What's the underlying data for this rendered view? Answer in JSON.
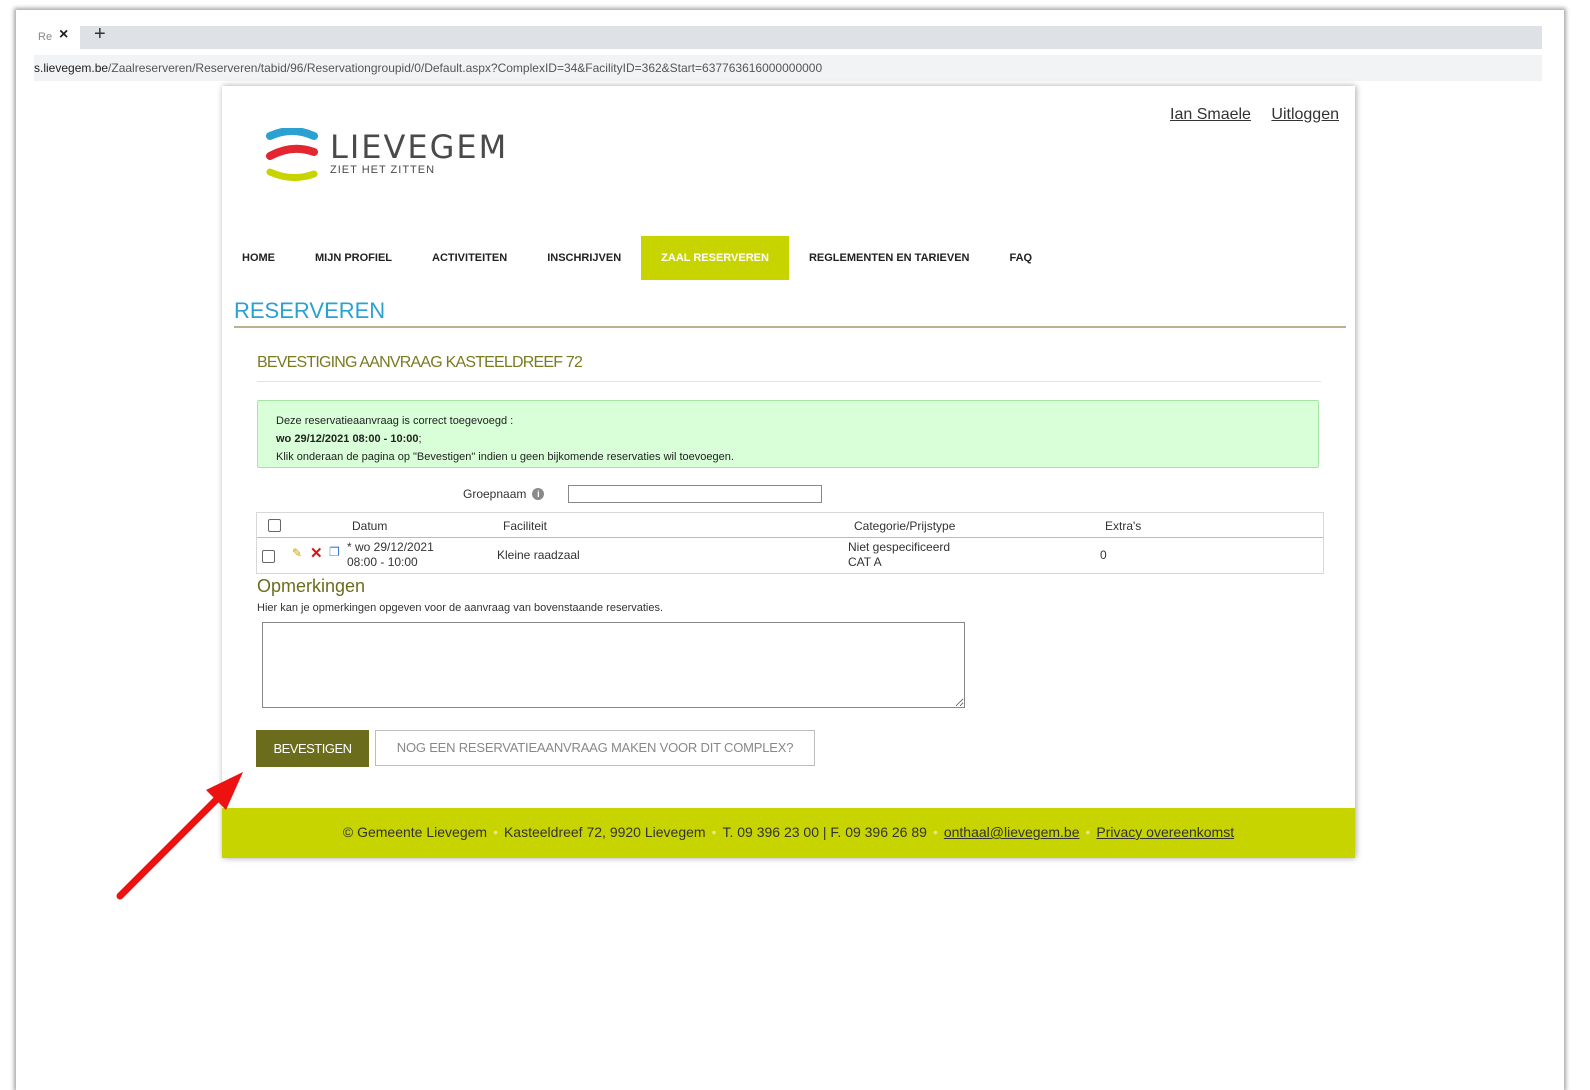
{
  "browser": {
    "tab_title": "Re",
    "tab_close": "×",
    "new_tab": "+",
    "url_host": "s.lievegem.be",
    "url_path": "/Zaalreserveren/Reserveren/tabid/96/Reservationgroupid/0/Default.aspx?ComplexID=34&FacilityID=362&Start=637763616000000000"
  },
  "header": {
    "user_name": "Ian Smaele",
    "logout": "Uitloggen",
    "logo_name": "LIEVEGEM",
    "logo_tagline": "ZIET HET ZITTEN"
  },
  "nav": {
    "items": [
      {
        "label": "HOME"
      },
      {
        "label": "MIJN PROFIEL"
      },
      {
        "label": "ACTIVITEITEN"
      },
      {
        "label": "INSCHRIJVEN"
      },
      {
        "label": "ZAAL RESERVEREN"
      },
      {
        "label": "REGLEMENTEN EN TARIEVEN"
      },
      {
        "label": "FAQ"
      }
    ],
    "active": "ZAAL RESERVEREN"
  },
  "page_title": "RESERVEREN",
  "section_title": "BEVESTIGING AANVRAAG  KASTEELDREEF 72",
  "success": {
    "line1": "Deze reservatieaanvraag is correct toegevoegd :",
    "line2_bold": "wo 29/12/2021 08:00 - 10:00",
    "line2_suffix": ";",
    "line3": "Klik onderaan de pagina op \"Bevestigen\" indien u geen bijkomende reservaties wil toevoegen."
  },
  "group": {
    "label": "Groepnaam",
    "info": "i",
    "value": ""
  },
  "table": {
    "headers": {
      "datum": "Datum",
      "faciliteit": "Faciliteit",
      "categorie": "Categorie/Prijstype",
      "extras": "Extra's"
    },
    "row": {
      "date_line1": "* wo 29/12/2021",
      "date_line2": "08:00 - 10:00",
      "faciliteit": "Kleine raadzaal",
      "categorie_line1": "Niet gespecificeerd",
      "categorie_line2": "CAT A",
      "extras": "0"
    }
  },
  "remarks": {
    "title": "Opmerkingen",
    "help": "Hier kan je opmerkingen opgeven voor de aanvraag van bovenstaande reservaties.",
    "value": ""
  },
  "buttons": {
    "confirm": "BEVESTIGEN",
    "another": "NOG EEN RESERVATIEAANVRAAG MAKEN VOOR DIT COMPLEX?"
  },
  "footer": {
    "copyright": "© Gemeente Lievegem",
    "address": "Kasteeldreef 72, 9920 Lievegem",
    "phone": "T. 09 396 23 00 | F. 09 396 26 89",
    "email": "onthaal@lievegem.be",
    "privacy": "Privacy overeenkomst"
  },
  "colors": {
    "accent_green": "#c8d400",
    "olive": "#6c6d1c",
    "title_blue": "#2aa1d1",
    "success_bg": "#d9ffd9",
    "annotation_arrow": "#ee1111"
  }
}
